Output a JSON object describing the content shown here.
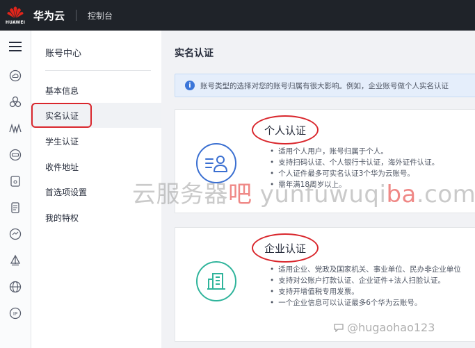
{
  "header": {
    "logo_text": "HUAWEI",
    "brand": "华为云",
    "console": "控制台"
  },
  "iconbar": {
    "items": [
      "cloud-icon",
      "cluster-icon",
      "monitor-icon",
      "database-icon",
      "storage-icon",
      "document-icon",
      "cloud-network-icon",
      "sail-icon",
      "globe-icon",
      "ip-icon"
    ],
    "ip_label": "IP"
  },
  "sidenav": {
    "title": "账号中心",
    "items": [
      {
        "label": "基本信息"
      },
      {
        "label": "实名认证"
      },
      {
        "label": "学生认证"
      },
      {
        "label": "收件地址"
      },
      {
        "label": "首选项设置"
      },
      {
        "label": "我的特权"
      }
    ],
    "active_index": 1
  },
  "main": {
    "title": "实名认证",
    "notice": "账号类型的选择对您的账号归属有很大影响。例如，企业账号做个人实名认证",
    "personal": {
      "title": "个人认证",
      "bullets": [
        "适用个人用户，账号归属于个人。",
        "支持扫码认证、个人银行卡认证，海外证件认证。",
        "个人证件最多可实名认证3个华为云账号。",
        "需年满18周岁以上。"
      ]
    },
    "enterprise": {
      "title": "企业认证",
      "bullets": [
        "适用企业、党政及国家机关、事业单位、民办非企业单位",
        "支持对公账户打款认证、企业证件+法人扫脸认证。",
        "支持开增值税专用发票。",
        "一个企业信息可以认证最多6个华为云账号。"
      ]
    }
  },
  "watermark": {
    "part1": "云服务器",
    "part2": "吧",
    "part3": " yunfuwuqi",
    "part4": "ba",
    "part5": ".com",
    "handle": "@hugaohao123"
  },
  "colors": {
    "accent_red": "#d9262c",
    "header_bg": "#1f2329",
    "personal_icon": "#3a6fd1",
    "enterprise_icon": "#2fb49b",
    "notice_bg": "#e5eefb"
  }
}
